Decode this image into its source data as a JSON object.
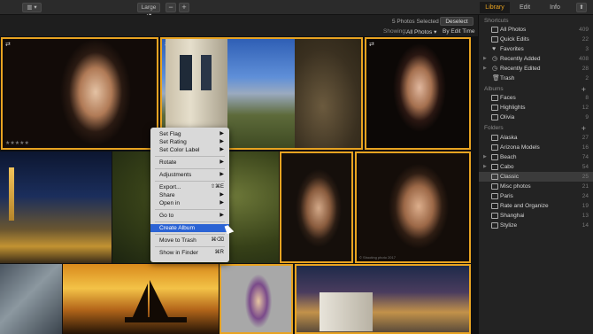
{
  "toolbar": {
    "sidebar_toggle": "▥ ▾",
    "size_select": "Large ▴▾",
    "zoom_out": "−",
    "zoom_in": "+",
    "tabs": [
      "Library",
      "Edit",
      "Info"
    ],
    "active_tab": "Library",
    "share": "⬆"
  },
  "status": {
    "selected": "5 Photos Selected",
    "deselect": "Deselect",
    "showing_label": "Showing:",
    "showing_value": "All Photos ▾",
    "sort": "By Edit Time ▾"
  },
  "photos": {
    "stars": "★★★★★",
    "caption": "© Shooting photo 2017"
  },
  "context_menu": {
    "items": [
      {
        "label": "Set Flag",
        "shortcut": "▶"
      },
      {
        "label": "Set Rating",
        "shortcut": "▶"
      },
      {
        "label": "Set Color Label",
        "shortcut": "▶"
      },
      {
        "label": "Rotate",
        "shortcut": "▶"
      },
      {
        "label": "Adjustments",
        "shortcut": "▶"
      },
      {
        "label": "Export...",
        "shortcut": "⇧⌘E"
      },
      {
        "label": "Share",
        "shortcut": "▶"
      },
      {
        "label": "Open in",
        "shortcut": "▶"
      },
      {
        "label": "Go to",
        "shortcut": "▶"
      },
      {
        "label": "Create Album",
        "shortcut": ""
      },
      {
        "label": "Move to Trash",
        "shortcut": "⌘⌫"
      },
      {
        "label": "Show in Finder",
        "shortcut": "⌘R"
      }
    ]
  },
  "sidebar": {
    "shortcuts_header": "Shortcuts",
    "shortcuts": [
      {
        "label": "All Photos",
        "count": "409"
      },
      {
        "label": "Quick Edits",
        "count": "22"
      },
      {
        "label": "Favorites",
        "count": "3"
      },
      {
        "label": "Recently Added",
        "count": "408"
      },
      {
        "label": "Recently Edited",
        "count": "28"
      },
      {
        "label": "Trash",
        "count": "2"
      }
    ],
    "albums_header": "Albums",
    "albums": [
      {
        "label": "Faces",
        "count": "8"
      },
      {
        "label": "Highlights",
        "count": "12"
      },
      {
        "label": "Olivia",
        "count": "9"
      }
    ],
    "folders_header": "Folders",
    "folders": [
      {
        "label": "Alaska",
        "count": "27"
      },
      {
        "label": "Arizona Models",
        "count": "16"
      },
      {
        "label": "Beach",
        "count": "74"
      },
      {
        "label": "Cabo",
        "count": "54"
      },
      {
        "label": "Classic",
        "count": "25"
      },
      {
        "label": "Misc photos",
        "count": "21"
      },
      {
        "label": "Paris",
        "count": "24"
      },
      {
        "label": "Rate and Organize",
        "count": "19"
      },
      {
        "label": "Shanghai",
        "count": "13"
      },
      {
        "label": "Stylize",
        "count": "14"
      }
    ],
    "selected_folder": "Classic"
  },
  "colors": {
    "accent": "#e8a321",
    "selection": "#2b63d4",
    "sidebar_selected": "#3b3b3b"
  }
}
